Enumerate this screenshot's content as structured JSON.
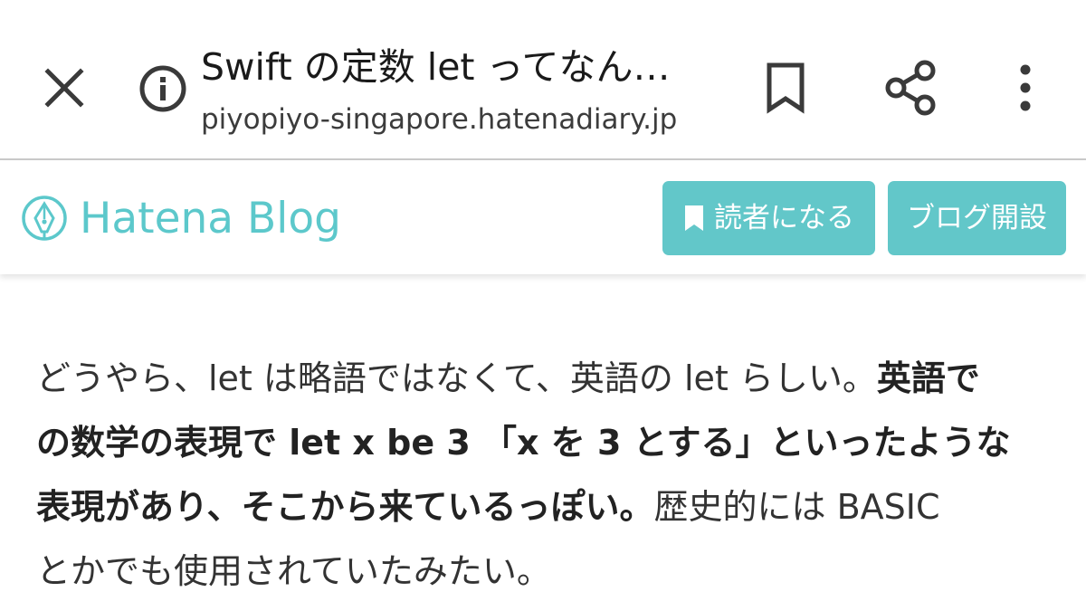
{
  "browser": {
    "title": "Swift の定数 let ってなん…",
    "url": "piyopiyo-singapore.hatenadiary.jp",
    "icons": {
      "close": "close-icon",
      "info": "info-icon",
      "bookmark": "bookmark-icon",
      "share": "share-icon",
      "menu": "more-vert-icon"
    }
  },
  "blog_header": {
    "logo_text": "Hatena Blog",
    "reader_button_label": "読者になる",
    "open_blog_button_label": "ブログ開設",
    "accent_color": "#62c7c9"
  },
  "article": {
    "lines": [
      {
        "normal": "どうやら、let は略語ではなくて、英語の let らしい。",
        "bold": "英語で"
      },
      {
        "bold": "の数学の表現で let x be 3 「x を 3 とする」といったような"
      },
      {
        "bold": "表現があり、そこから来ているっぽい。",
        "normal": "歴史的には BASIC"
      },
      {
        "normal": "とかでも使用されていたみたい。"
      }
    ]
  }
}
